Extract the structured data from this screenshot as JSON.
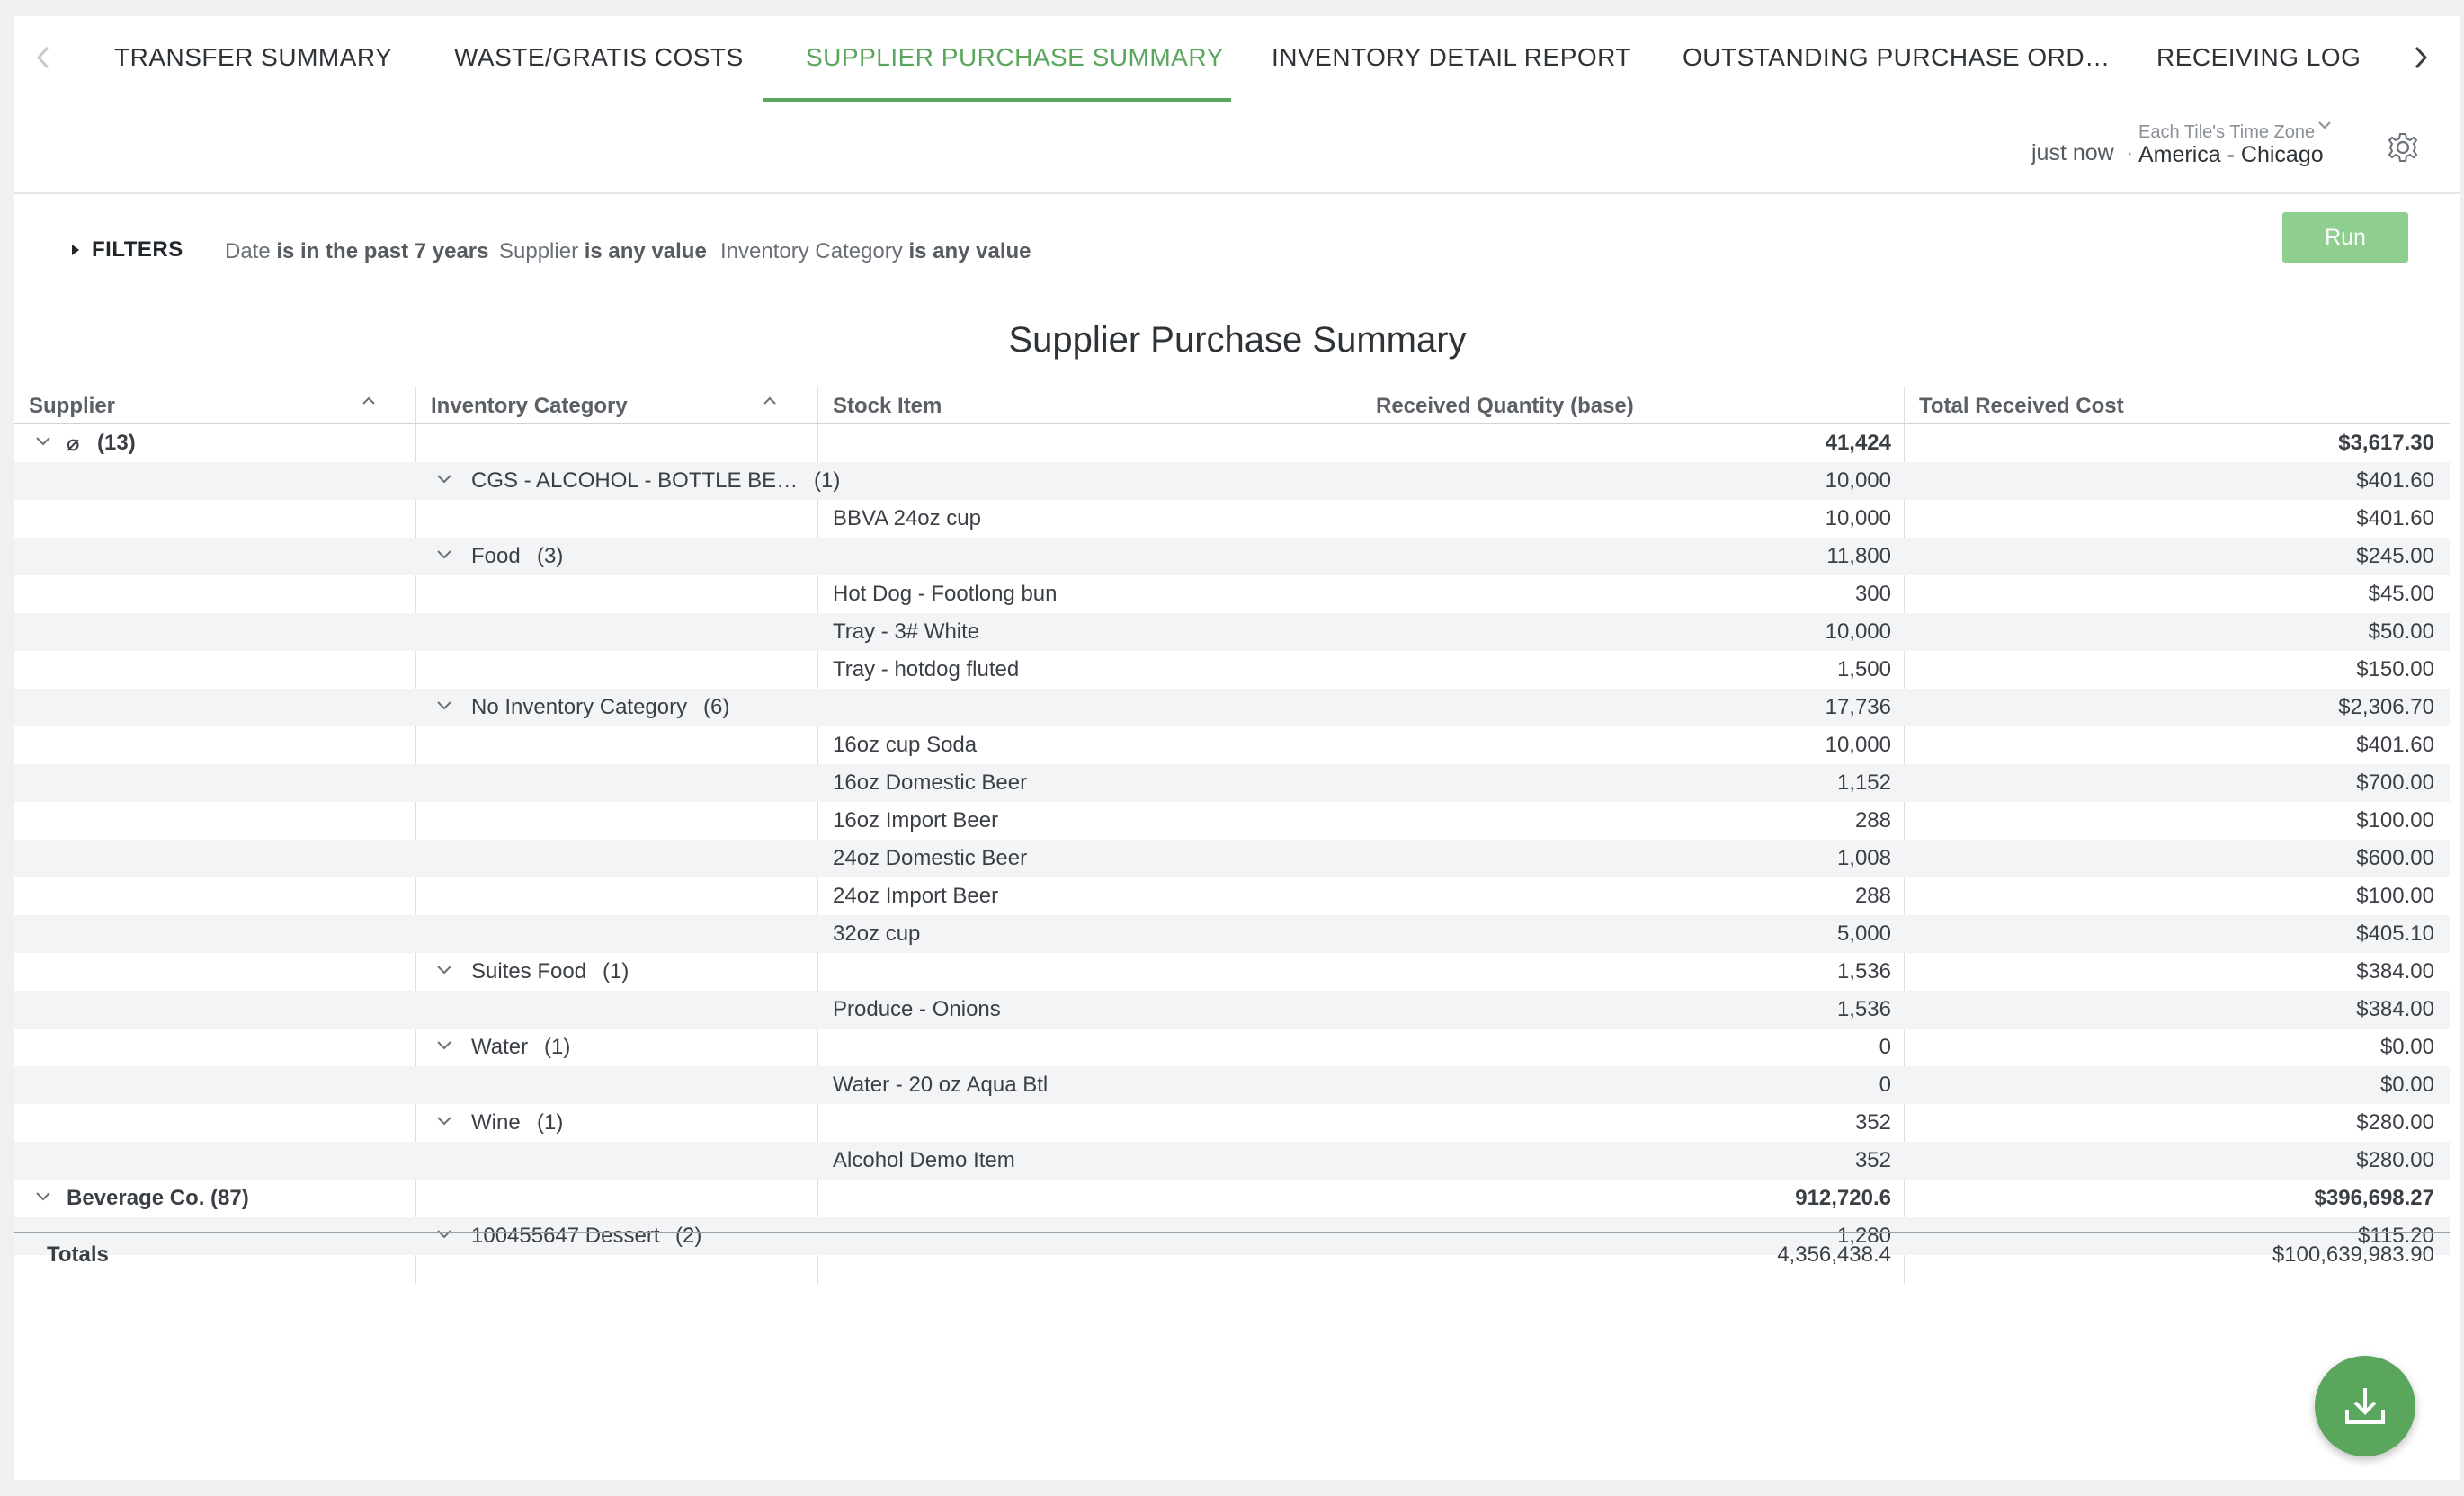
{
  "tabs": [
    {
      "label": "TRANSFER SUMMARY"
    },
    {
      "label": "WASTE/GRATIS COSTS"
    },
    {
      "label": "SUPPLIER PURCHASE SUMMARY"
    },
    {
      "label": "INVENTORY DETAIL REPORT"
    },
    {
      "label": "OUTSTANDING PURCHASE ORD…"
    },
    {
      "label": "RECEIVING LOG"
    }
  ],
  "active_tab": "SUPPLIER PURCHASE SUMMARY",
  "timebar": {
    "updated": "just now",
    "separator": "·",
    "tz_label": "Each Tile's Time Zone",
    "tz_value": "America - Chicago"
  },
  "filters": {
    "label": "FILTERS",
    "items": [
      {
        "field": "Date",
        "op": "is in the past 7 years"
      },
      {
        "field": "Supplier",
        "op": "is any value"
      },
      {
        "field": "Inventory Category",
        "op": "is any value"
      }
    ],
    "run_label": "Run"
  },
  "report": {
    "title": "Supplier Purchase Summary",
    "columns": [
      "Supplier",
      "Inventory Category",
      "Stock Item",
      "Received Quantity (base)",
      "Total Received Cost"
    ],
    "rows": [
      {
        "level": 0,
        "supplier": "⌀",
        "count": "(13)",
        "qty": "41,424",
        "cost": "$3,617.30"
      },
      {
        "level": 1,
        "category": "CGS - ALCOHOL - BOTTLE BE…",
        "count": "(1)",
        "qty": "10,000",
        "cost": "$401.60"
      },
      {
        "level": 2,
        "item": "BBVA 24oz cup",
        "qty": "10,000",
        "cost": "$401.60"
      },
      {
        "level": 1,
        "category": "Food",
        "count": "(3)",
        "qty": "11,800",
        "cost": "$245.00"
      },
      {
        "level": 2,
        "item": "Hot Dog - Footlong bun",
        "qty": "300",
        "cost": "$45.00"
      },
      {
        "level": 2,
        "item": "Tray - 3# White",
        "qty": "10,000",
        "cost": "$50.00"
      },
      {
        "level": 2,
        "item": "Tray - hotdog fluted",
        "qty": "1,500",
        "cost": "$150.00"
      },
      {
        "level": 1,
        "category": "No Inventory Category",
        "count": "(6)",
        "qty": "17,736",
        "cost": "$2,306.70"
      },
      {
        "level": 2,
        "item": "16oz cup Soda",
        "qty": "10,000",
        "cost": "$401.60"
      },
      {
        "level": 2,
        "item": "16oz Domestic Beer",
        "qty": "1,152",
        "cost": "$700.00"
      },
      {
        "level": 2,
        "item": "16oz Import Beer",
        "qty": "288",
        "cost": "$100.00"
      },
      {
        "level": 2,
        "item": "24oz Domestic Beer",
        "qty": "1,008",
        "cost": "$600.00"
      },
      {
        "level": 2,
        "item": "24oz Import Beer",
        "qty": "288",
        "cost": "$100.00"
      },
      {
        "level": 2,
        "item": "32oz cup",
        "qty": "5,000",
        "cost": "$405.10"
      },
      {
        "level": 1,
        "category": "Suites Food",
        "count": "(1)",
        "qty": "1,536",
        "cost": "$384.00"
      },
      {
        "level": 2,
        "item": "Produce - Onions",
        "qty": "1,536",
        "cost": "$384.00"
      },
      {
        "level": 1,
        "category": "Water",
        "count": "(1)",
        "qty": "0",
        "cost": "$0.00"
      },
      {
        "level": 2,
        "item": "Water - 20 oz Aqua Btl",
        "qty": "0",
        "cost": "$0.00"
      },
      {
        "level": 1,
        "category": "Wine",
        "count": "(1)",
        "qty": "352",
        "cost": "$280.00"
      },
      {
        "level": 2,
        "item": "Alcohol Demo Item",
        "qty": "352",
        "cost": "$280.00"
      },
      {
        "level": 0,
        "supplier": "Beverage Co.",
        "count": "(87)",
        "qty": "912,720.6",
        "cost": "$396,698.27"
      },
      {
        "level": 1,
        "category": "100455647 Dessert",
        "count": "(2)",
        "qty": "1,280",
        "cost": "$115.20"
      }
    ],
    "totals": {
      "label": "Totals",
      "qty": "4,356,438.4",
      "cost": "$100,639,983.90"
    }
  },
  "colors": {
    "accent": "#5aa65c",
    "run_button": "#8ecf8f"
  }
}
